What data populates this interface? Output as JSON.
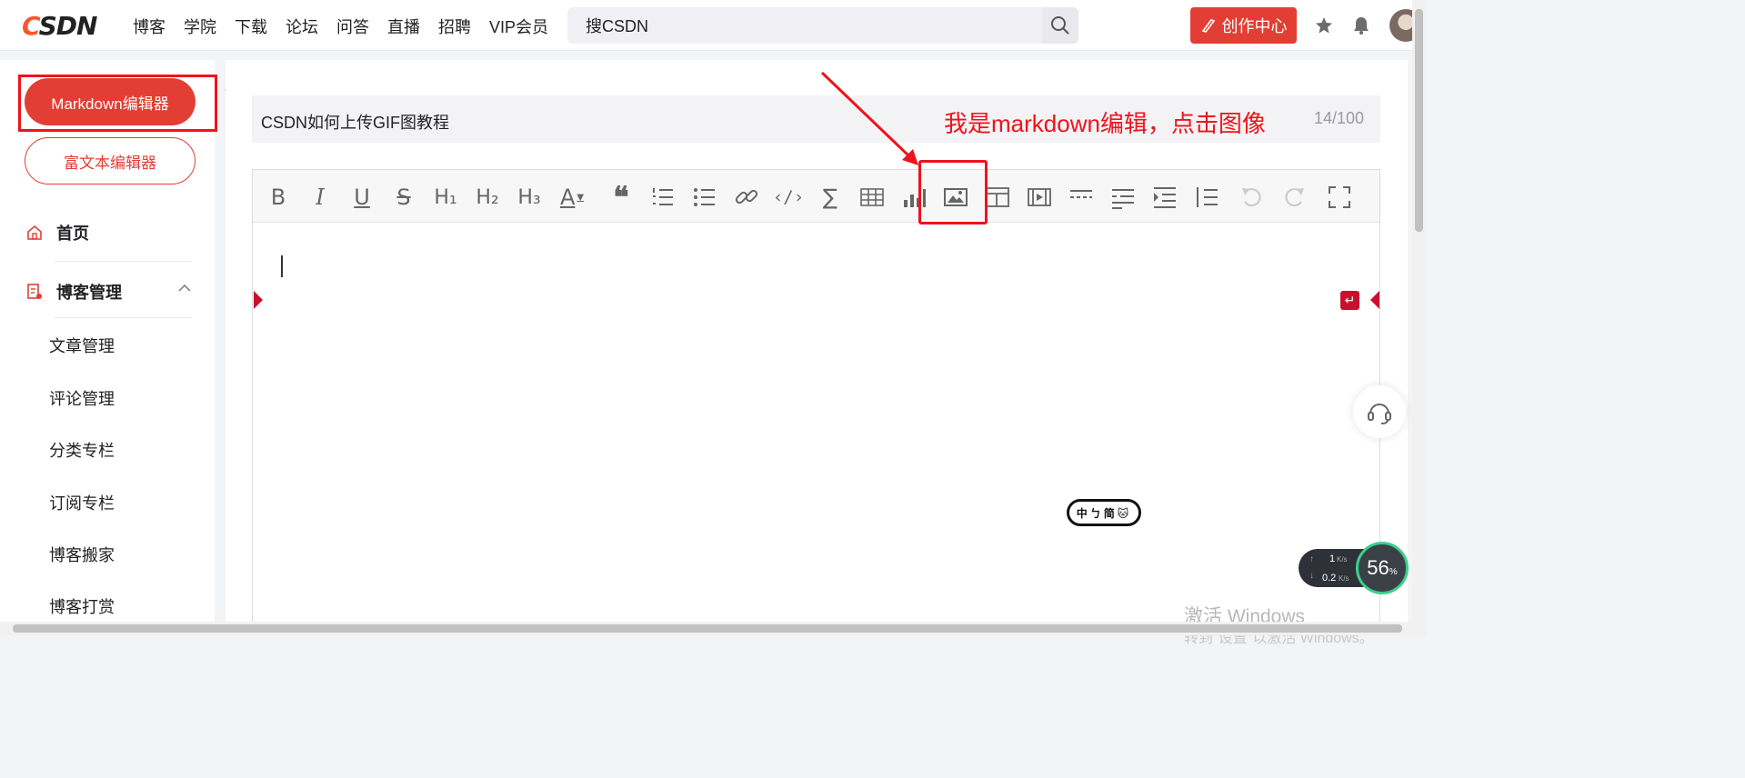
{
  "header": {
    "logo_left": "C",
    "logo_right": "SDN",
    "nav": [
      "博客",
      "学院",
      "下载",
      "论坛",
      "问答",
      "直播",
      "招聘",
      "VIP会员"
    ],
    "search_value": "搜CSDN",
    "create_label": "创作中心"
  },
  "sidebar": {
    "markdown_button": "Markdown编辑器",
    "rich_button": "富文本编辑器",
    "home": "首页",
    "blog_manage": "博客管理",
    "sub_items": [
      "文章管理",
      "评论管理",
      "分类专栏",
      "订阅专栏",
      "博客搬家",
      "博客打赏"
    ]
  },
  "editor": {
    "title": "CSDN如何上传GIF图教程",
    "title_count": "14/100",
    "annotation": "我是markdown编辑，点击图像"
  },
  "ime_label": "中ㄅ简🐱",
  "speed": {
    "up": "1",
    "down": "0.2",
    "unit": "K/s",
    "percent": "56",
    "percent_unit": "%"
  },
  "watermark": {
    "line1": "激活 Windows",
    "line2": "转到\"设置\"以激活 Windows。"
  },
  "colors": {
    "brand_red": "#e33e33",
    "annotation_red": "#f0121b",
    "logo_red": "#fc5531"
  }
}
